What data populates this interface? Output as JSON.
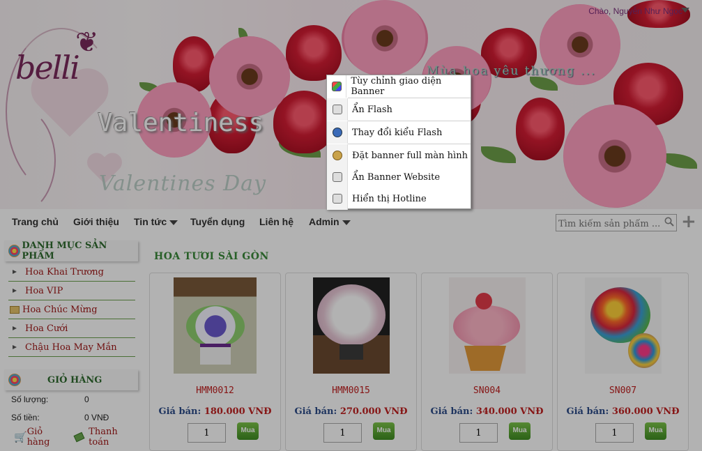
{
  "header": {
    "greeting": "Chào, Nguyễn Như Ngọc",
    "logo_text": "belli",
    "banner_title": "Valentiness",
    "banner_script": "Valentines Day",
    "banner_slogan": "Mùa hoa yêu thương ..."
  },
  "nav": {
    "items": [
      "Trang chủ",
      "Giới thiệu",
      "Tin tức",
      "Tuyển dụng",
      "Liên hệ",
      "Admin"
    ]
  },
  "search": {
    "placeholder": "Tìm kiếm sản phẩm ..."
  },
  "context_menu": {
    "items": [
      "Tùy chỉnh giao diện Banner",
      "Ẩn Flash",
      "Thay đổi kiểu Flash",
      "Đặt banner full màn hình",
      "Ẩn Banner Website",
      "Hiển thị Hotline"
    ]
  },
  "sidebar": {
    "categories_title": "DANH MỤC SẢN PHẨM",
    "categories": [
      "Hoa Khai Trương",
      "Hoa VIP",
      "Hoa Chúc Mừng",
      "Hoa Cưới",
      "Chậu Hoa May Mắn"
    ],
    "cart_title": "GIỎ HÀNG",
    "cart_qty_label": "Số lượng:",
    "cart_qty_value": "0",
    "cart_total_label": "Số tiền:",
    "cart_total_value": "0 VNĐ",
    "cart_link": "Giỏ hàng",
    "checkout_link": "Thanh toán"
  },
  "section_title": "HOA TƯƠI SÀI GÒN",
  "products": [
    {
      "code": "HMM0012",
      "price_label": "Giá bán:",
      "price": "180.000 VNĐ",
      "qty": "1",
      "buy": "Mua"
    },
    {
      "code": "HMM0015",
      "price_label": "Giá bán:",
      "price": "270.000 VNĐ",
      "qty": "1",
      "buy": "Mua"
    },
    {
      "code": "SN004",
      "price_label": "Giá bán:",
      "price": "340.000 VNĐ",
      "qty": "1",
      "buy": "Mua"
    },
    {
      "code": "SN007",
      "price_label": "Giá bán:",
      "price": "360.000 VNĐ",
      "qty": "1",
      "buy": "Mua"
    }
  ]
}
